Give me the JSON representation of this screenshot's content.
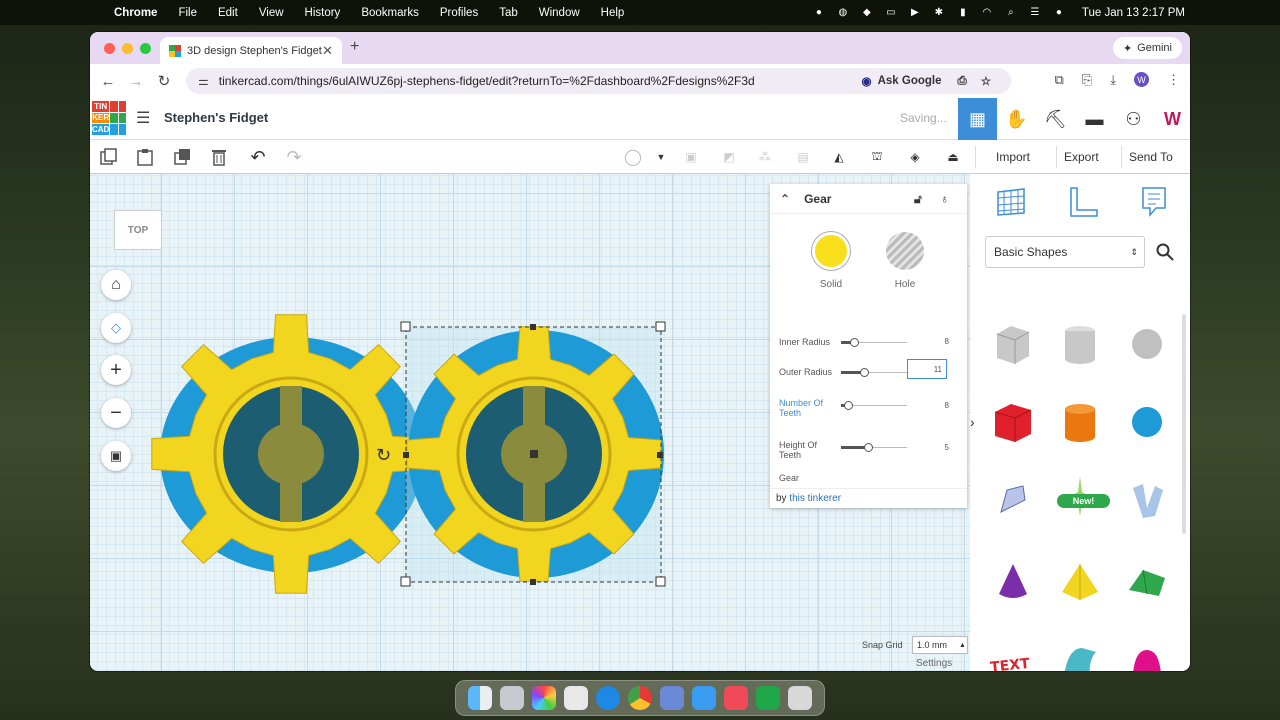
{
  "menubar": {
    "app": "Chrome",
    "items": [
      "File",
      "Edit",
      "View",
      "History",
      "Bookmarks",
      "Profiles",
      "Tab",
      "Window",
      "Help"
    ],
    "clock": "Tue Jan 13  2:17 PM"
  },
  "browser": {
    "tab_title": "3D design Stephen's Fidget -",
    "gemini": "Gemini",
    "url": "tinkercad.com/things/6ulAIWUZ6pj-stephens-fidget/edit?returnTo=%2Fdashboard%2Fdesigns%2F3d",
    "ask_google": "Ask Google"
  },
  "tinkercad": {
    "logo": [
      "TIN",
      "KER",
      "CAD"
    ],
    "design_title": "Stephen's Fidget",
    "status": "Saving...",
    "actions": {
      "import": "Import",
      "export": "Export",
      "send_to": "Send To"
    },
    "view_cube": "TOP"
  },
  "inspector": {
    "title": "Gear",
    "solid": "Solid",
    "hole": "Hole",
    "params": [
      {
        "label": "Inner Radius",
        "value": "8",
        "level": 0.2
      },
      {
        "label": "Outer Radius",
        "value": "11",
        "level": 0.35
      },
      {
        "label": "Number Of Teeth",
        "value": "8",
        "level": 0.1
      },
      {
        "label": "Height Of Teeth",
        "value": "5",
        "level": 0.4
      }
    ],
    "shape_name": "Gear",
    "by_prefix": "by",
    "author": "this tinkerer"
  },
  "grid": {
    "settings": "Settings",
    "snap_label": "Snap Grid",
    "snap_value": "1.0 mm"
  },
  "library": {
    "category": "Basic Shapes",
    "new_badge": "New!",
    "text_shape": "TEXT"
  },
  "colors": {
    "solid": "#f7e01b",
    "gear": "#f2d51e",
    "gear_back": "#1e9ad6",
    "accent": "#2a6fbf",
    "selected_tool": "#3c8ed8"
  }
}
